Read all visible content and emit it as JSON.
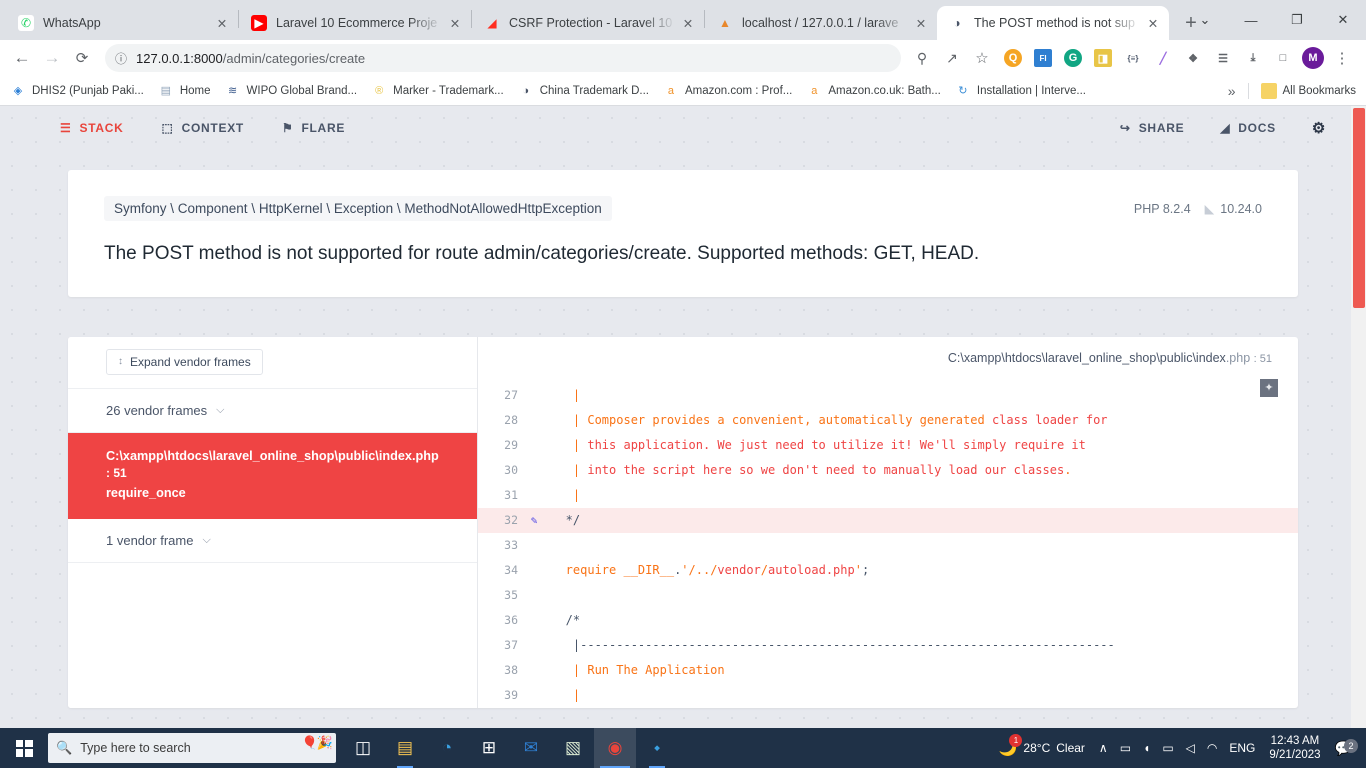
{
  "browser": {
    "tabs": [
      {
        "title": "WhatsApp",
        "favicon": "whatsapp-icon",
        "active": false
      },
      {
        "title": "Laravel 10 Ecommerce Proje",
        "favicon": "youtube-icon",
        "active": false
      },
      {
        "title": "CSRF Protection - Laravel 10",
        "favicon": "laravel-icon",
        "active": false
      },
      {
        "title": "localhost / 127.0.0.1 / larave",
        "favicon": "phpmyadmin-icon",
        "active": false
      },
      {
        "title": "The POST method is not sup",
        "favicon": "globe-icon",
        "active": true
      }
    ],
    "new_tab_label": "+",
    "close_label": "×",
    "window_controls": {
      "tab_search": "⌄",
      "minimize": "—",
      "maximize": "❐",
      "close": "✕"
    },
    "toolbar": {
      "back": "←",
      "forward": "→",
      "reload": "⟳",
      "site_info": "ⓘ",
      "url_host": "127.0.0.1:8000",
      "url_path": "/admin/categories/create",
      "url_full": "127.0.0.1:8000/admin/categories/create",
      "zoom_out_icon": "search-minus-icon",
      "share_icon": "share-icon",
      "bookmark_icon": "star-icon",
      "extensions": [
        {
          "name": "search-extension",
          "glyph": "Q",
          "color": "#f5a524"
        },
        {
          "name": "formatter-extension",
          "glyph": "FI",
          "color": "#2f7fd1"
        },
        {
          "name": "grammarly-extension",
          "glyph": "G",
          "color": "#11a683"
        },
        {
          "name": "colorful-extension",
          "glyph": "◨",
          "color": "#e8c547"
        },
        {
          "name": "code-extension",
          "glyph": "{≡}",
          "color": "#4a5568"
        },
        {
          "name": "pen-extension",
          "glyph": "╱",
          "color": "#9b6ddf"
        },
        {
          "name": "puzzle-extension",
          "glyph": "❖",
          "color": "#5f6368"
        },
        {
          "name": "reading-list-icon",
          "glyph": "☰",
          "color": "#5f6368"
        },
        {
          "name": "downloads-icon",
          "glyph": "⤓",
          "color": "#5f6368"
        },
        {
          "name": "sidepanel-icon",
          "glyph": "□",
          "color": "#5f6368"
        }
      ],
      "profile_initial": "M",
      "menu": "⋮"
    },
    "bookmarks": [
      {
        "label": "DHIS2 (Punjab Paki...",
        "icon": "dhis2-icon",
        "color": "#2b7fd6"
      },
      {
        "label": "Home",
        "icon": "document-icon",
        "color": "#8fa3b8"
      },
      {
        "label": "WIPO Global Brand...",
        "icon": "wipo-icon",
        "color": "#3b5a8c"
      },
      {
        "label": "Marker - Trademark...",
        "icon": "registered-icon",
        "color": "#e8c547"
      },
      {
        "label": "China Trademark D...",
        "icon": "globe-icon",
        "color": "#4a5568"
      },
      {
        "label": "Amazon.com : Prof...",
        "icon": "amazon-icon",
        "color": "#f0932b"
      },
      {
        "label": "Amazon.co.uk: Bath...",
        "icon": "amazon-icon",
        "color": "#f0932b"
      },
      {
        "label": "Installation | Interve...",
        "icon": "intervention-icon",
        "color": "#3b8ed6"
      }
    ],
    "bookmarks_overflow": "»",
    "all_bookmarks_label": "All Bookmarks",
    "all_bookmarks_icon": "folder-icon"
  },
  "ignition": {
    "nav": {
      "left": [
        {
          "label": "STACK",
          "icon": "stack-icon",
          "glyph": "☰",
          "active": true
        },
        {
          "label": "CONTEXT",
          "icon": "context-icon",
          "glyph": "⬚",
          "active": false
        },
        {
          "label": "FLARE",
          "icon": "flare-icon",
          "glyph": "⚑",
          "active": false
        }
      ],
      "right": [
        {
          "label": "SHARE",
          "icon": "share-icon",
          "glyph": "↪"
        },
        {
          "label": "DOCS",
          "icon": "laravel-icon",
          "glyph": "◢"
        }
      ],
      "settings_icon": "gear-icon",
      "settings_glyph": "⚙"
    },
    "exception": {
      "class": "Symfony \\ Component \\ HttpKernel \\ Exception \\ MethodNotAllowedHttpException",
      "php_version": "PHP 8.2.4",
      "laravel_version": "10.24.0",
      "laravel_icon": "laravel-icon",
      "message": "The POST method is not supported for route admin/categories/create. Supported methods: GET, HEAD."
    },
    "frames": {
      "expand_button": "Expand vendor frames",
      "expand_icon": "sort-icon",
      "expand_glyph": "↕",
      "vendor_top": {
        "label": "26 vendor frames",
        "chevron": "⌵"
      },
      "active_frame": {
        "path": "C:\\xampp\\htdocs\\laravel_online_shop\\public\\index.php",
        "line": ": 51",
        "function": "require_once"
      },
      "vendor_bottom": {
        "label": "1 vendor frame",
        "chevron": "⌵"
      }
    },
    "code": {
      "file_path": "C:\\xampp\\htdocs\\laravel_online_shop\\public\\index",
      "file_ext": ".php",
      "file_line": ": 51",
      "editor_badge_icon": "sublime-icon",
      "lines": [
        {
          "num": "27",
          "highlighted": false,
          "pen": false,
          "tokens": [
            {
              "t": "    | ",
              "c": "cm"
            }
          ]
        },
        {
          "num": "28",
          "highlighted": false,
          "pen": false,
          "tokens": [
            {
              "t": "    | Composer provides a convenient, automatically generated ",
              "c": "cm"
            },
            {
              "t": "class loader for",
              "c": "cm-red"
            }
          ]
        },
        {
          "num": "29",
          "highlighted": false,
          "pen": false,
          "tokens": [
            {
              "t": "    | ",
              "c": "cm"
            },
            {
              "t": "this application. We just need to utilize it! We'll simply require it",
              "c": "cm-red"
            }
          ]
        },
        {
          "num": "30",
          "highlighted": false,
          "pen": false,
          "tokens": [
            {
              "t": "    | ",
              "c": "cm"
            },
            {
              "t": "into the script here so we don't need to manually load our classes",
              "c": "cm-red"
            },
            {
              "t": ".",
              "c": "cm"
            }
          ]
        },
        {
          "num": "31",
          "highlighted": false,
          "pen": false,
          "tokens": [
            {
              "t": "    | ",
              "c": "cm"
            }
          ]
        },
        {
          "num": "32",
          "highlighted": true,
          "pen": true,
          "tokens": [
            {
              "t": "   */",
              "c": "pun"
            }
          ]
        },
        {
          "num": "33",
          "highlighted": false,
          "pen": false,
          "tokens": [
            {
              "t": "",
              "c": "pun"
            }
          ]
        },
        {
          "num": "34",
          "highlighted": false,
          "pen": false,
          "tokens": [
            {
              "t": "   require ",
              "c": "kw"
            },
            {
              "t": "__DIR__",
              "c": "cnst"
            },
            {
              "t": ".",
              "c": "pun"
            },
            {
              "t": "'/../",
              "c": "str"
            },
            {
              "t": "vendor",
              "c": "cm-red"
            },
            {
              "t": "/",
              "c": "str"
            },
            {
              "t": "autoload.php",
              "c": "cm-red"
            },
            {
              "t": "'",
              "c": "str"
            },
            {
              "t": ";",
              "c": "pun"
            }
          ]
        },
        {
          "num": "35",
          "highlighted": false,
          "pen": false,
          "tokens": [
            {
              "t": "",
              "c": "pun"
            }
          ]
        },
        {
          "num": "36",
          "highlighted": false,
          "pen": false,
          "tokens": [
            {
              "t": "   /*",
              "c": "pun"
            }
          ]
        },
        {
          "num": "37",
          "highlighted": false,
          "pen": false,
          "tokens": [
            {
              "t": "    |--------------------------------------------------------------------------",
              "c": "pun"
            }
          ]
        },
        {
          "num": "38",
          "highlighted": false,
          "pen": false,
          "tokens": [
            {
              "t": "    | ",
              "c": "cm"
            },
            {
              "t": "Run The Application",
              "c": "cm"
            }
          ]
        },
        {
          "num": "39",
          "highlighted": false,
          "pen": false,
          "tokens": [
            {
              "t": "    | ",
              "c": "cm"
            }
          ]
        }
      ]
    }
  },
  "taskbar": {
    "start_icon": "windows-logo-icon",
    "search_placeholder": "Type here to search",
    "search_icon": "magnifier-icon",
    "decoration_icon": "festival-banner-icon",
    "task_view_icon": "task-view-icon",
    "apps": [
      {
        "name": "file-explorer-icon",
        "glyph": "▤",
        "color": "#f5c453",
        "state": "open"
      },
      {
        "name": "edge-icon",
        "glyph": "◔",
        "color": "#3aa0e0",
        "state": "none"
      },
      {
        "name": "microsoft-store-icon",
        "glyph": "⊞",
        "color": "#ffffff",
        "state": "none"
      },
      {
        "name": "mail-icon",
        "glyph": "✉",
        "color": "#2f7fd1",
        "state": "none"
      },
      {
        "name": "notepad-icon",
        "glyph": "▧",
        "color": "#d9e8d0",
        "state": "none"
      },
      {
        "name": "chrome-icon",
        "glyph": "◉",
        "color": "#e8453c",
        "state": "active"
      },
      {
        "name": "vscode-icon",
        "glyph": "⬩",
        "color": "#3aa0e0",
        "state": "open"
      }
    ],
    "weather": {
      "temp": "28°C",
      "condition": "Clear",
      "icon": "moon-icon",
      "badge": "1"
    },
    "tray": [
      {
        "name": "show-hidden-icons",
        "glyph": "∧"
      },
      {
        "name": "camera-icon",
        "glyph": "▭"
      },
      {
        "name": "headset-muted-icon",
        "glyph": "◖"
      },
      {
        "name": "battery-icon",
        "glyph": "▭"
      },
      {
        "name": "volume-icon",
        "glyph": "◁"
      },
      {
        "name": "wifi-icon",
        "glyph": "◠"
      }
    ],
    "language": "ENG",
    "time": "12:43 AM",
    "date": "9/21/2023",
    "notification_icon": "notification-icon",
    "notification_count": "2"
  }
}
